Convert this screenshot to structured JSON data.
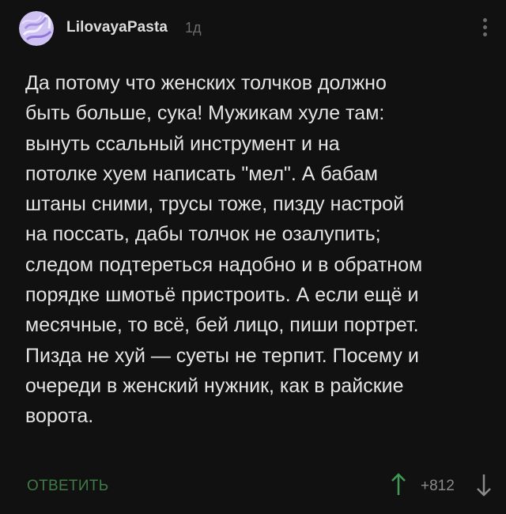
{
  "post": {
    "author": "LilovayaPasta",
    "age": "1д",
    "avatar_icon": "lilac-scribble-avatar",
    "lines": [
      "Да потому что женских толчков должно",
      "быть больше, сука! Мужикам хуле там:",
      "вынуть ссальный инструмент и на",
      "потолке хуем написать \"мел\". А бабам",
      "штаны сними, трусы тоже, пизду настрой",
      "на поссать, дабы толчок не озалупить;",
      "следом подтереться надобно и в обратном",
      "порядке шмотьё пристроить. А если ещё и",
      "месячные, то всё, бей лицо, пиши портрет.",
      "Пизда не хуй — суеты не терпит. Посему и",
      "очереди в женский нужник, как в райские",
      "ворота."
    ]
  },
  "actions": {
    "reply_label": "ОТВЕТИТЬ",
    "score": "+812",
    "upvote_icon": "arrow-up-icon",
    "downvote_icon": "arrow-down-icon",
    "more_icon": "vertical-dots-icon"
  },
  "colors": {
    "background": "#111111",
    "text": "#e4e4e4",
    "muted": "#6c6c6c",
    "accent_green": "#3f7a47",
    "avatar_lilac": "#b8a6e8"
  }
}
